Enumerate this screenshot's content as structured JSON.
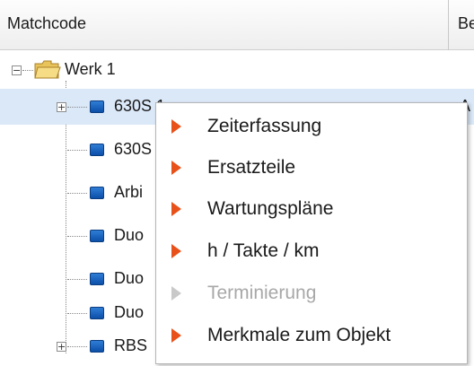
{
  "header": {
    "col_matchcode": "Matchcode",
    "col_b": "Be"
  },
  "tree": {
    "root": {
      "label": "Werk 1",
      "toggle": "−"
    },
    "children": [
      {
        "label": "630S 1",
        "toggle": "+",
        "right_text": "A"
      },
      {
        "label": "630S",
        "right_text": ""
      },
      {
        "label": "Arbi",
        "right_text": ""
      },
      {
        "label": "Duo",
        "right_text": ""
      },
      {
        "label": "Duo",
        "right_text": ""
      },
      {
        "label": "Duo",
        "right_text": ""
      },
      {
        "label": "RBS",
        "toggle": "+",
        "right_text": ""
      }
    ]
  },
  "context_menu": {
    "items": [
      {
        "label": "Zeiterfassung",
        "enabled": true
      },
      {
        "label": "Ersatzteile",
        "enabled": true
      },
      {
        "label": "Wartungspläne",
        "enabled": true
      },
      {
        "label": "h / Takte / km",
        "enabled": true
      },
      {
        "label": "Terminierung",
        "enabled": false
      },
      {
        "label": "Merkmale zum Objekt",
        "enabled": true
      }
    ]
  },
  "colors": {
    "accent": "#e8521a",
    "selection": "#dbe8f8",
    "disabled": "#a8a8a8"
  }
}
